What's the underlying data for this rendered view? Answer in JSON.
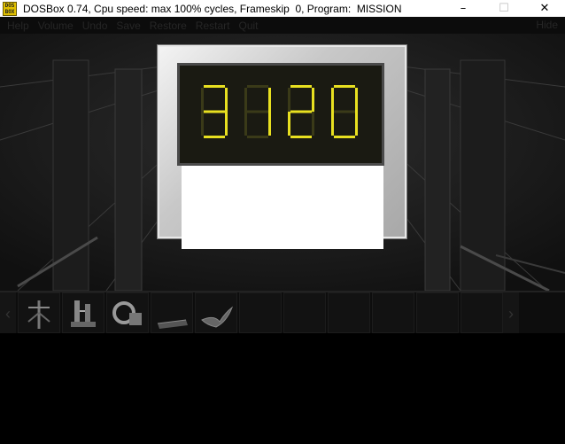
{
  "window": {
    "title": "DOSBox 0.74, Cpu speed: max 100% cycles, Frameskip  0, Program:  MISSION",
    "icon_name": "dosbox-icon",
    "icon_text": "DOS BOX",
    "controls": {
      "minimize": "–",
      "maximize": "☐",
      "close": "✕"
    }
  },
  "menu": {
    "items": [
      "Help",
      "Volume",
      "Undo",
      "Save",
      "Restore",
      "Restart",
      "Quit"
    ],
    "right": "Hide"
  },
  "display": {
    "digits": "3120",
    "digit_color": "#e8e020",
    "digit_off_color": "#3a3a18"
  },
  "inventory": {
    "left_arrow": "‹",
    "right_arrow": "›",
    "slots": [
      {
        "icon": "antenna-icon",
        "filled": true
      },
      {
        "icon": "machine-icon",
        "filled": true
      },
      {
        "icon": "canister-icon",
        "filled": true
      },
      {
        "icon": "book-icon",
        "filled": true
      },
      {
        "icon": "cloth-icon",
        "filled": true
      },
      {
        "icon": "",
        "filled": false
      },
      {
        "icon": "",
        "filled": false
      },
      {
        "icon": "",
        "filled": false
      },
      {
        "icon": "",
        "filled": false
      },
      {
        "icon": "",
        "filled": false
      },
      {
        "icon": "",
        "filled": false
      },
      {
        "icon": "",
        "filled": false
      }
    ]
  }
}
